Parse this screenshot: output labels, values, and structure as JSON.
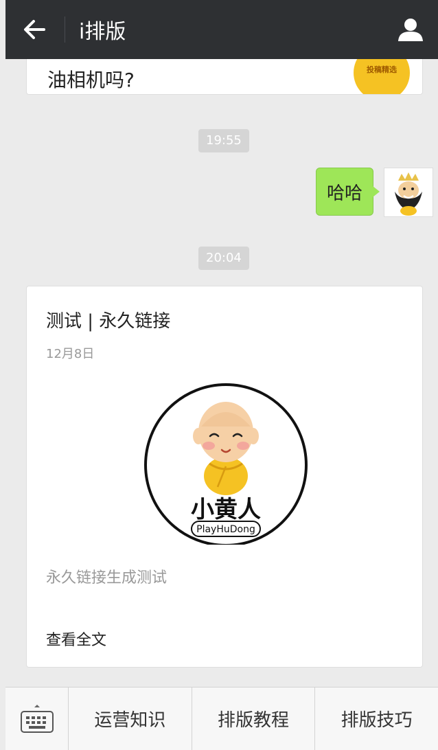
{
  "header": {
    "title": "i排版",
    "back_icon": "arrow-left-icon",
    "profile_icon": "user-icon"
  },
  "previous_card": {
    "text": "油相机吗?",
    "badge_text": "投稿精选"
  },
  "messages": [
    {
      "type": "timestamp",
      "text": "19:55"
    },
    {
      "type": "outgoing",
      "text": "哈哈"
    },
    {
      "type": "timestamp",
      "text": "20:04"
    }
  ],
  "article": {
    "title": "测试 | 永久链接",
    "date": "12月8日",
    "logo_text": "小黄人",
    "logo_subtext": "PlayHuDong",
    "summary": "永久链接生成测试",
    "read_more": "查看全文"
  },
  "bottom_menu": {
    "keyboard_icon": "keyboard-icon",
    "items": [
      {
        "label": "运营知识"
      },
      {
        "label": "排版教程"
      },
      {
        "label": "排版技巧"
      }
    ]
  },
  "colors": {
    "header_bg": "#2e3033",
    "chat_bg": "#ebebeb",
    "bubble_green": "#9ee658",
    "badge_yellow": "#f5c223"
  }
}
